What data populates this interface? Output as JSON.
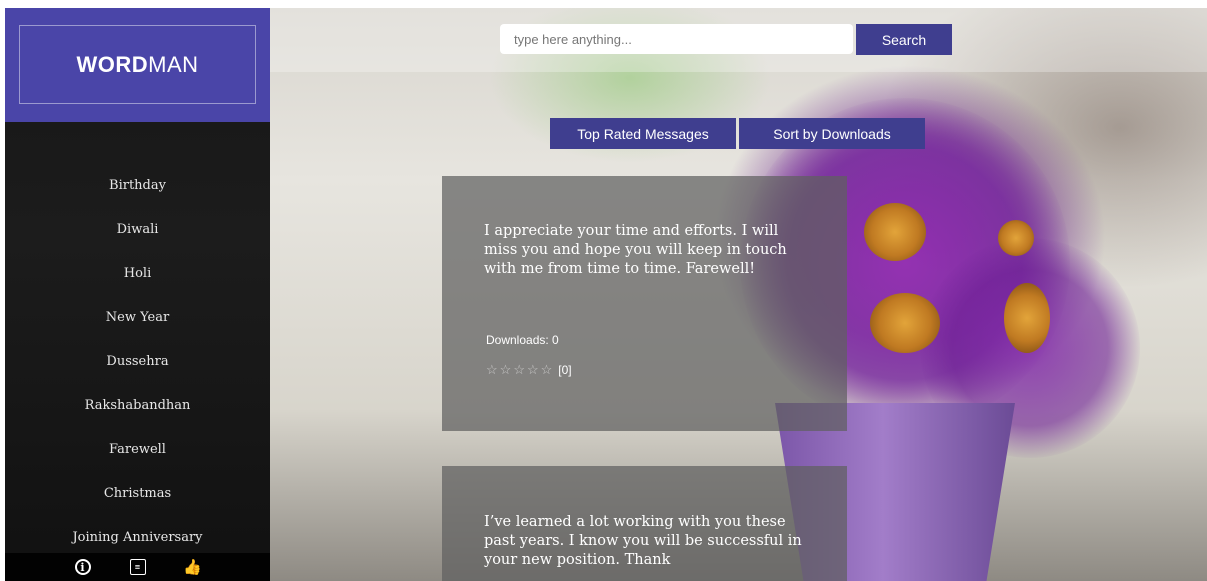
{
  "brand": {
    "bold": "WORD",
    "light": "MAN"
  },
  "sidebar": {
    "items": [
      {
        "label": "Birthday"
      },
      {
        "label": "Diwali"
      },
      {
        "label": "Holi"
      },
      {
        "label": "New Year"
      },
      {
        "label": "Dussehra"
      },
      {
        "label": "Rakshabandhan"
      },
      {
        "label": "Farewell"
      },
      {
        "label": "Christmas"
      },
      {
        "label": "Joining Anniversary"
      }
    ],
    "footer_icons": [
      "info-icon",
      "book-icon",
      "thumbs-up-icon"
    ]
  },
  "search": {
    "placeholder": "type here anything...",
    "button_label": "Search"
  },
  "sort": {
    "top_rated_label": "Top Rated Messages",
    "downloads_label": "Sort by Downloads"
  },
  "messages": [
    {
      "text": "I appreciate your time and efforts. I will miss you and hope you will keep in touch with me from time to time. Farewell!",
      "downloads": "Downloads: 0",
      "rating": 0,
      "rating_count": "[0]"
    },
    {
      "text": "I’ve learned a lot working with you these past years. I know you will be successful in your new position. Thank"
    }
  ],
  "colors": {
    "brand": "#4a45a8",
    "button": "#3f3e8f",
    "sidebar": "#161616"
  }
}
